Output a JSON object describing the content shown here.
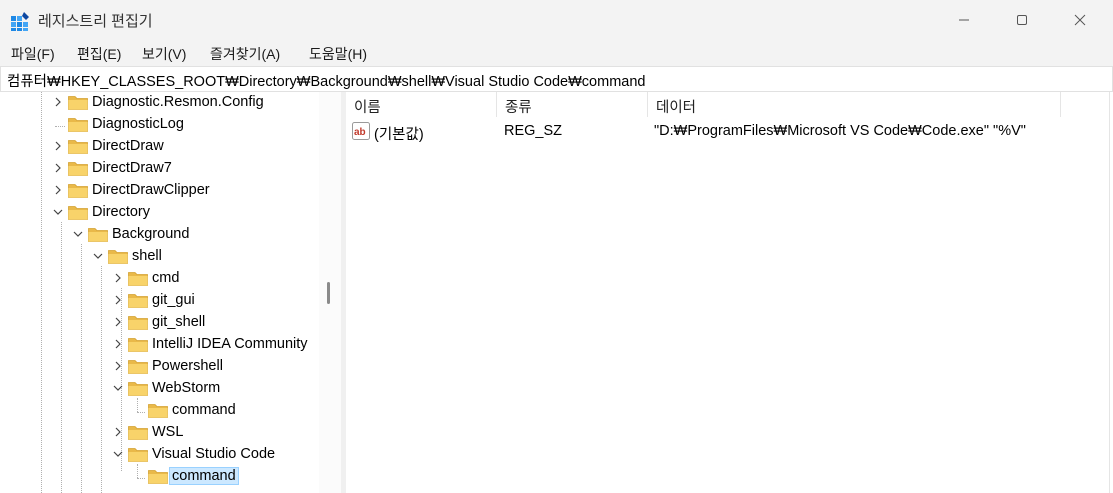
{
  "window": {
    "title": "레지스트리 편집기",
    "controls": {
      "minimize": "minimize",
      "maximize": "maximize",
      "close": "close"
    }
  },
  "menu": [
    "파일(F)",
    "편집(E)",
    "보기(V)",
    "즐겨찾기(A)",
    "도움말(H)"
  ],
  "address": "컴퓨터₩HKEY_CLASSES_ROOT₩Directory₩Background₩shell₩Visual Studio Code₩command",
  "tree": [
    {
      "label": "Diagnostic.Resmon.Config",
      "expander": "collapsed"
    },
    {
      "label": "DiagnosticLog",
      "expander": "none"
    },
    {
      "label": "DirectDraw",
      "expander": "collapsed"
    },
    {
      "label": "DirectDraw7",
      "expander": "collapsed"
    },
    {
      "label": "DirectDrawClipper",
      "expander": "collapsed"
    },
    {
      "label": "Directory",
      "expander": "expanded"
    },
    {
      "label": "Background",
      "expander": "expanded"
    },
    {
      "label": "shell",
      "expander": "expanded"
    },
    {
      "label": "cmd",
      "expander": "collapsed"
    },
    {
      "label": "git_gui",
      "expander": "collapsed"
    },
    {
      "label": "git_shell",
      "expander": "collapsed"
    },
    {
      "label": "IntelliJ IDEA Community",
      "expander": "collapsed"
    },
    {
      "label": "Powershell",
      "expander": "collapsed"
    },
    {
      "label": "WebStorm",
      "expander": "expanded"
    },
    {
      "label": "command",
      "expander": "none"
    },
    {
      "label": "WSL",
      "expander": "collapsed"
    },
    {
      "label": "Visual Studio Code",
      "expander": "expanded"
    },
    {
      "label": "command",
      "expander": "none",
      "selected": true
    }
  ],
  "list": {
    "columns": [
      "이름",
      "종류",
      "데이터"
    ],
    "rows": [
      {
        "name": "(기본값)",
        "type": "REG_SZ",
        "data": "\"D:₩ProgramFiles₩Microsoft VS Code₩Code.exe\" \"%V\"",
        "icon": "string-value-icon"
      }
    ]
  },
  "colors": {
    "folder": "#f8d36a",
    "selection": "#cce8ff",
    "titlebar": "#f3f3f3"
  }
}
